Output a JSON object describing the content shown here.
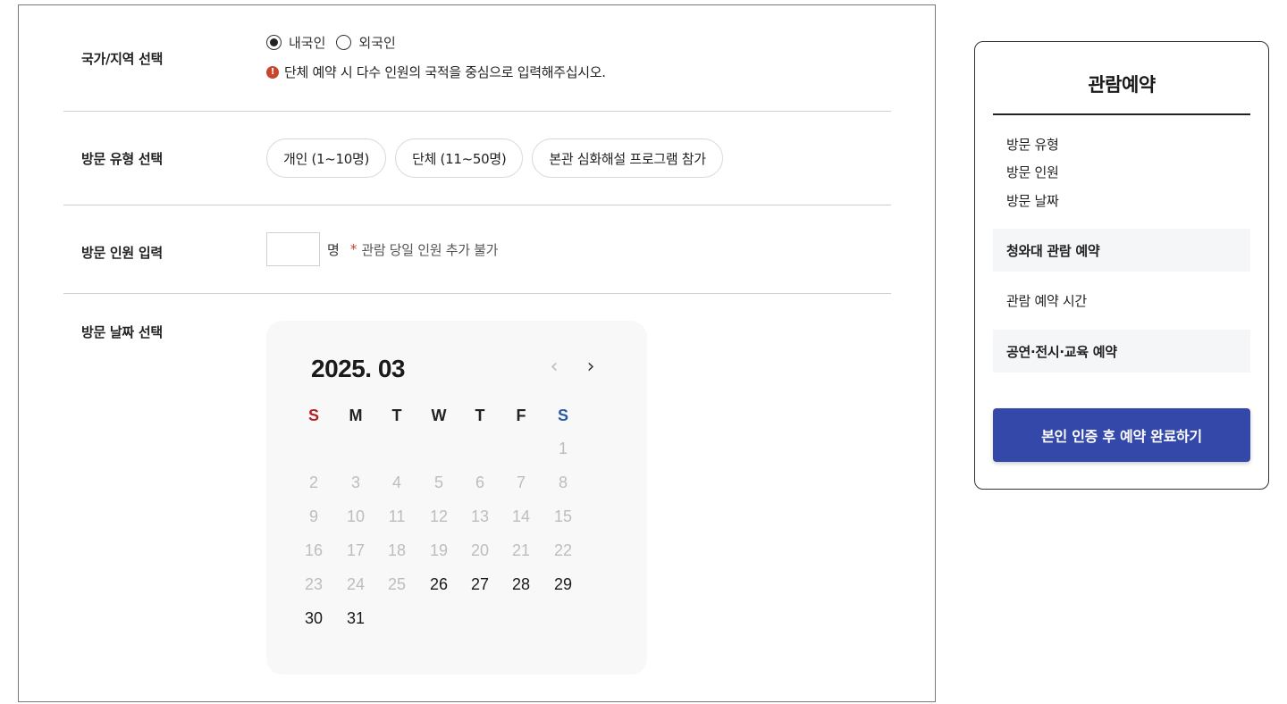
{
  "form": {
    "nationality": {
      "label": "국가/지역 선택",
      "options": [
        "내국인",
        "외국인"
      ],
      "selected": "내국인",
      "notice_icon": "info-icon",
      "notice": "단체 예약 시 다수 인원의 국적을 중심으로 입력해주십시오."
    },
    "visit_type": {
      "label": "방문 유형 선택",
      "options": [
        "개인 (1~10명)",
        "단체 (11~50명)",
        "본관 심화해설 프로그램 참가"
      ]
    },
    "people": {
      "label": "방문 인원 입력",
      "value": "",
      "unit": "명",
      "note_mark": "*",
      "note": "관람 당일 인원 추가 불가"
    },
    "date": {
      "label": "방문 날짜 선택"
    }
  },
  "calendar": {
    "title": "2025. 03",
    "prev_icon": "chevron-left-icon",
    "next_icon": "chevron-right-icon",
    "prev_glyph": "‹",
    "next_glyph": "›",
    "weekdays": [
      "S",
      "M",
      "T",
      "W",
      "T",
      "F",
      "S"
    ],
    "first_weekday_index": 6,
    "days_in_month": 31,
    "first_available_day": 26,
    "colors": {
      "sunday": "#b0232a",
      "saturday": "#2a5aa6",
      "available": "#1a1a1a",
      "disabled": "#bdbdbd"
    }
  },
  "summary": {
    "title": "관람예약",
    "items": [
      "방문 유형",
      "방문 인원",
      "방문 날짜"
    ],
    "section1": "청와대 관람 예약",
    "section1_item": "관람 예약 시간",
    "section2": "공연·전시·교육 예약",
    "submit": "본인 인증 후 예약 완료하기"
  },
  "colors": {
    "accent": "#3348a8",
    "warning": "#c8452e"
  }
}
